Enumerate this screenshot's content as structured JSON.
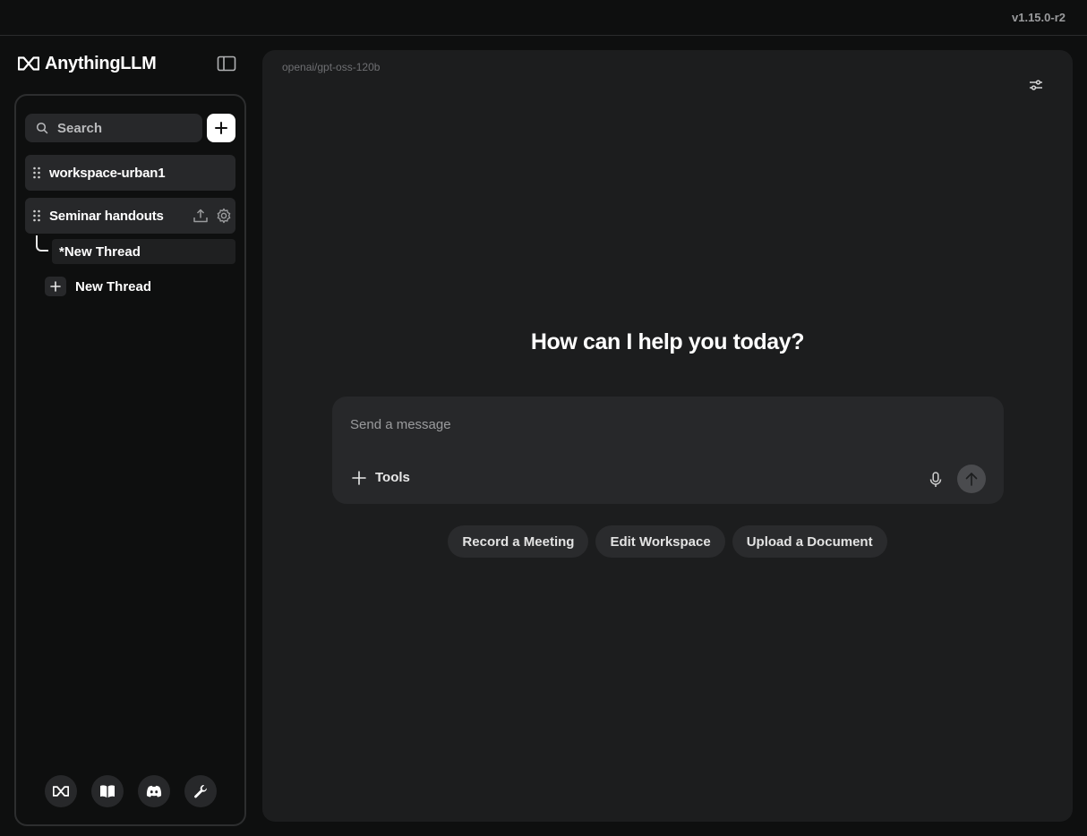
{
  "app": {
    "version": "v1.15.0-r2",
    "brand": "AnythingLLM"
  },
  "sidebar": {
    "search_label": "Search",
    "workspaces": [
      {
        "label": "workspace-urban1"
      },
      {
        "label": "Seminar handouts"
      }
    ],
    "threads": [
      {
        "label": "*New Thread"
      }
    ],
    "new_thread_label": "New Thread",
    "footer_icons": [
      "anythingllm-logo-icon",
      "book-icon",
      "discord-icon",
      "wrench-icon"
    ]
  },
  "main": {
    "model": "openai/gpt-oss-120b",
    "greeting": "How can I help you today?",
    "composer": {
      "placeholder": "Send a message",
      "tools_label": "Tools"
    },
    "suggestions": [
      {
        "label": "Record a Meeting"
      },
      {
        "label": "Edit Workspace"
      },
      {
        "label": "Upload a Document"
      }
    ]
  },
  "colors": {
    "background": "#0e0f0f",
    "panel": "#1c1d1e",
    "surface": "#27282a",
    "text": "#ffffff",
    "muted": "#9a9b9d"
  }
}
